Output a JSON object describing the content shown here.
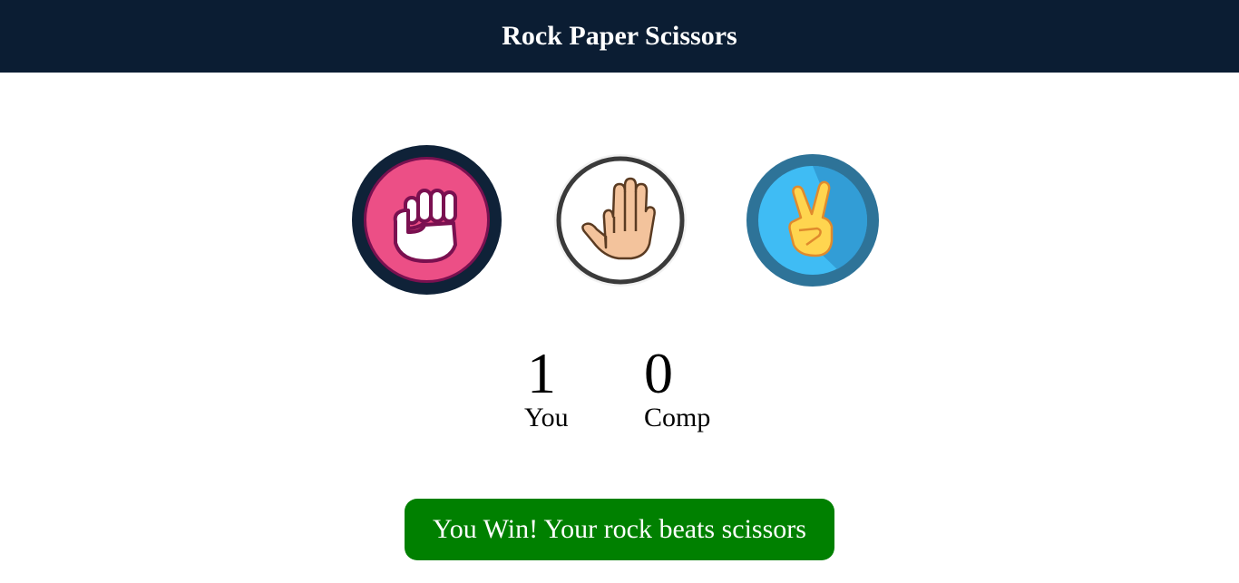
{
  "header": {
    "title": "Rock Paper Scissors"
  },
  "choices": [
    {
      "id": "rock",
      "icon": "fist-icon",
      "ring_color": "#0f2238",
      "fill_color": "#ec4f86"
    },
    {
      "id": "paper",
      "icon": "open-hand-icon",
      "ring_color": "#3a3a3a",
      "fill_color": "#ffffff"
    },
    {
      "id": "scissors",
      "icon": "peace-hand-icon",
      "ring_color": "#2e7398",
      "fill_color": "#3fbcf4"
    }
  ],
  "scoreboard": {
    "user": {
      "score": "1",
      "label": "You"
    },
    "comp": {
      "score": "0",
      "label": "Comp"
    }
  },
  "result": {
    "message": "You Win! Your rock beats scissors",
    "color": "#008000"
  }
}
